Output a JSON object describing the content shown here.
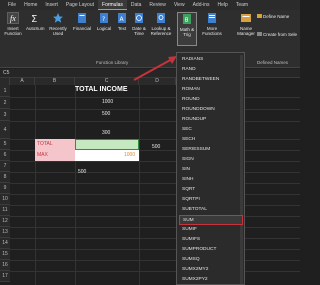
{
  "tabs": [
    "File",
    "Home",
    "Insert",
    "Page Layout",
    "Formulas",
    "Data",
    "Review",
    "View",
    "Add-ins",
    "Help",
    "Team"
  ],
  "active_tab_index": 4,
  "ribbon": {
    "insert_function": "Insert Function",
    "autosum": "AutoSum",
    "recently_used": "Recently Used",
    "financial": "Financial",
    "logical": "Logical",
    "text": "Text",
    "date_time": "Date & Time",
    "lookup_reference": "Lookup & Reference",
    "math_trig": "Math & Trig",
    "more_functions": "More Functions",
    "name_manager": "Name Manager",
    "define_name": "Define Name",
    "create_from_selection": "Create from Sele",
    "function_library_label": "Function Library",
    "defined_names_label": "Defined Names"
  },
  "namebox": "C5",
  "columns": [
    "A",
    "B",
    "C",
    "D"
  ],
  "rows": [
    "1",
    "2",
    "3",
    "4",
    "5",
    "6",
    "7",
    "8",
    "9",
    "10",
    "11",
    "12",
    "13",
    "14",
    "15",
    "16",
    "17"
  ],
  "cells": {
    "title": "TOTAL INCOME",
    "c2": "1000",
    "c3": "500",
    "c4": "300",
    "b5": "TOTAL",
    "d5": "500",
    "b6": "MAX",
    "c6": "1000",
    "b8": "500"
  },
  "menu_items": [
    "RADIANS",
    "RAND",
    "RANDBETWEEN",
    "ROMAN",
    "ROUND",
    "ROUNDDOWN",
    "ROUNDUP",
    "SEC",
    "SECH",
    "SERIESSUM",
    "SIGN",
    "SIN",
    "SINH",
    "SQRT",
    "SQRTPI",
    "SUBTOTAL",
    "SUM",
    "SUMIF",
    "SUMIFS",
    "SUMPRODUCT",
    "SUMSQ",
    "SUMX2MY2",
    "SUMX2PY2"
  ],
  "selected_menu_item": "SUM",
  "colors": {
    "accent": "#6fbf73",
    "highlight_red": "#c7333a",
    "pink_fill": "#f4c6cc",
    "green_fill": "#c6e8c0"
  }
}
